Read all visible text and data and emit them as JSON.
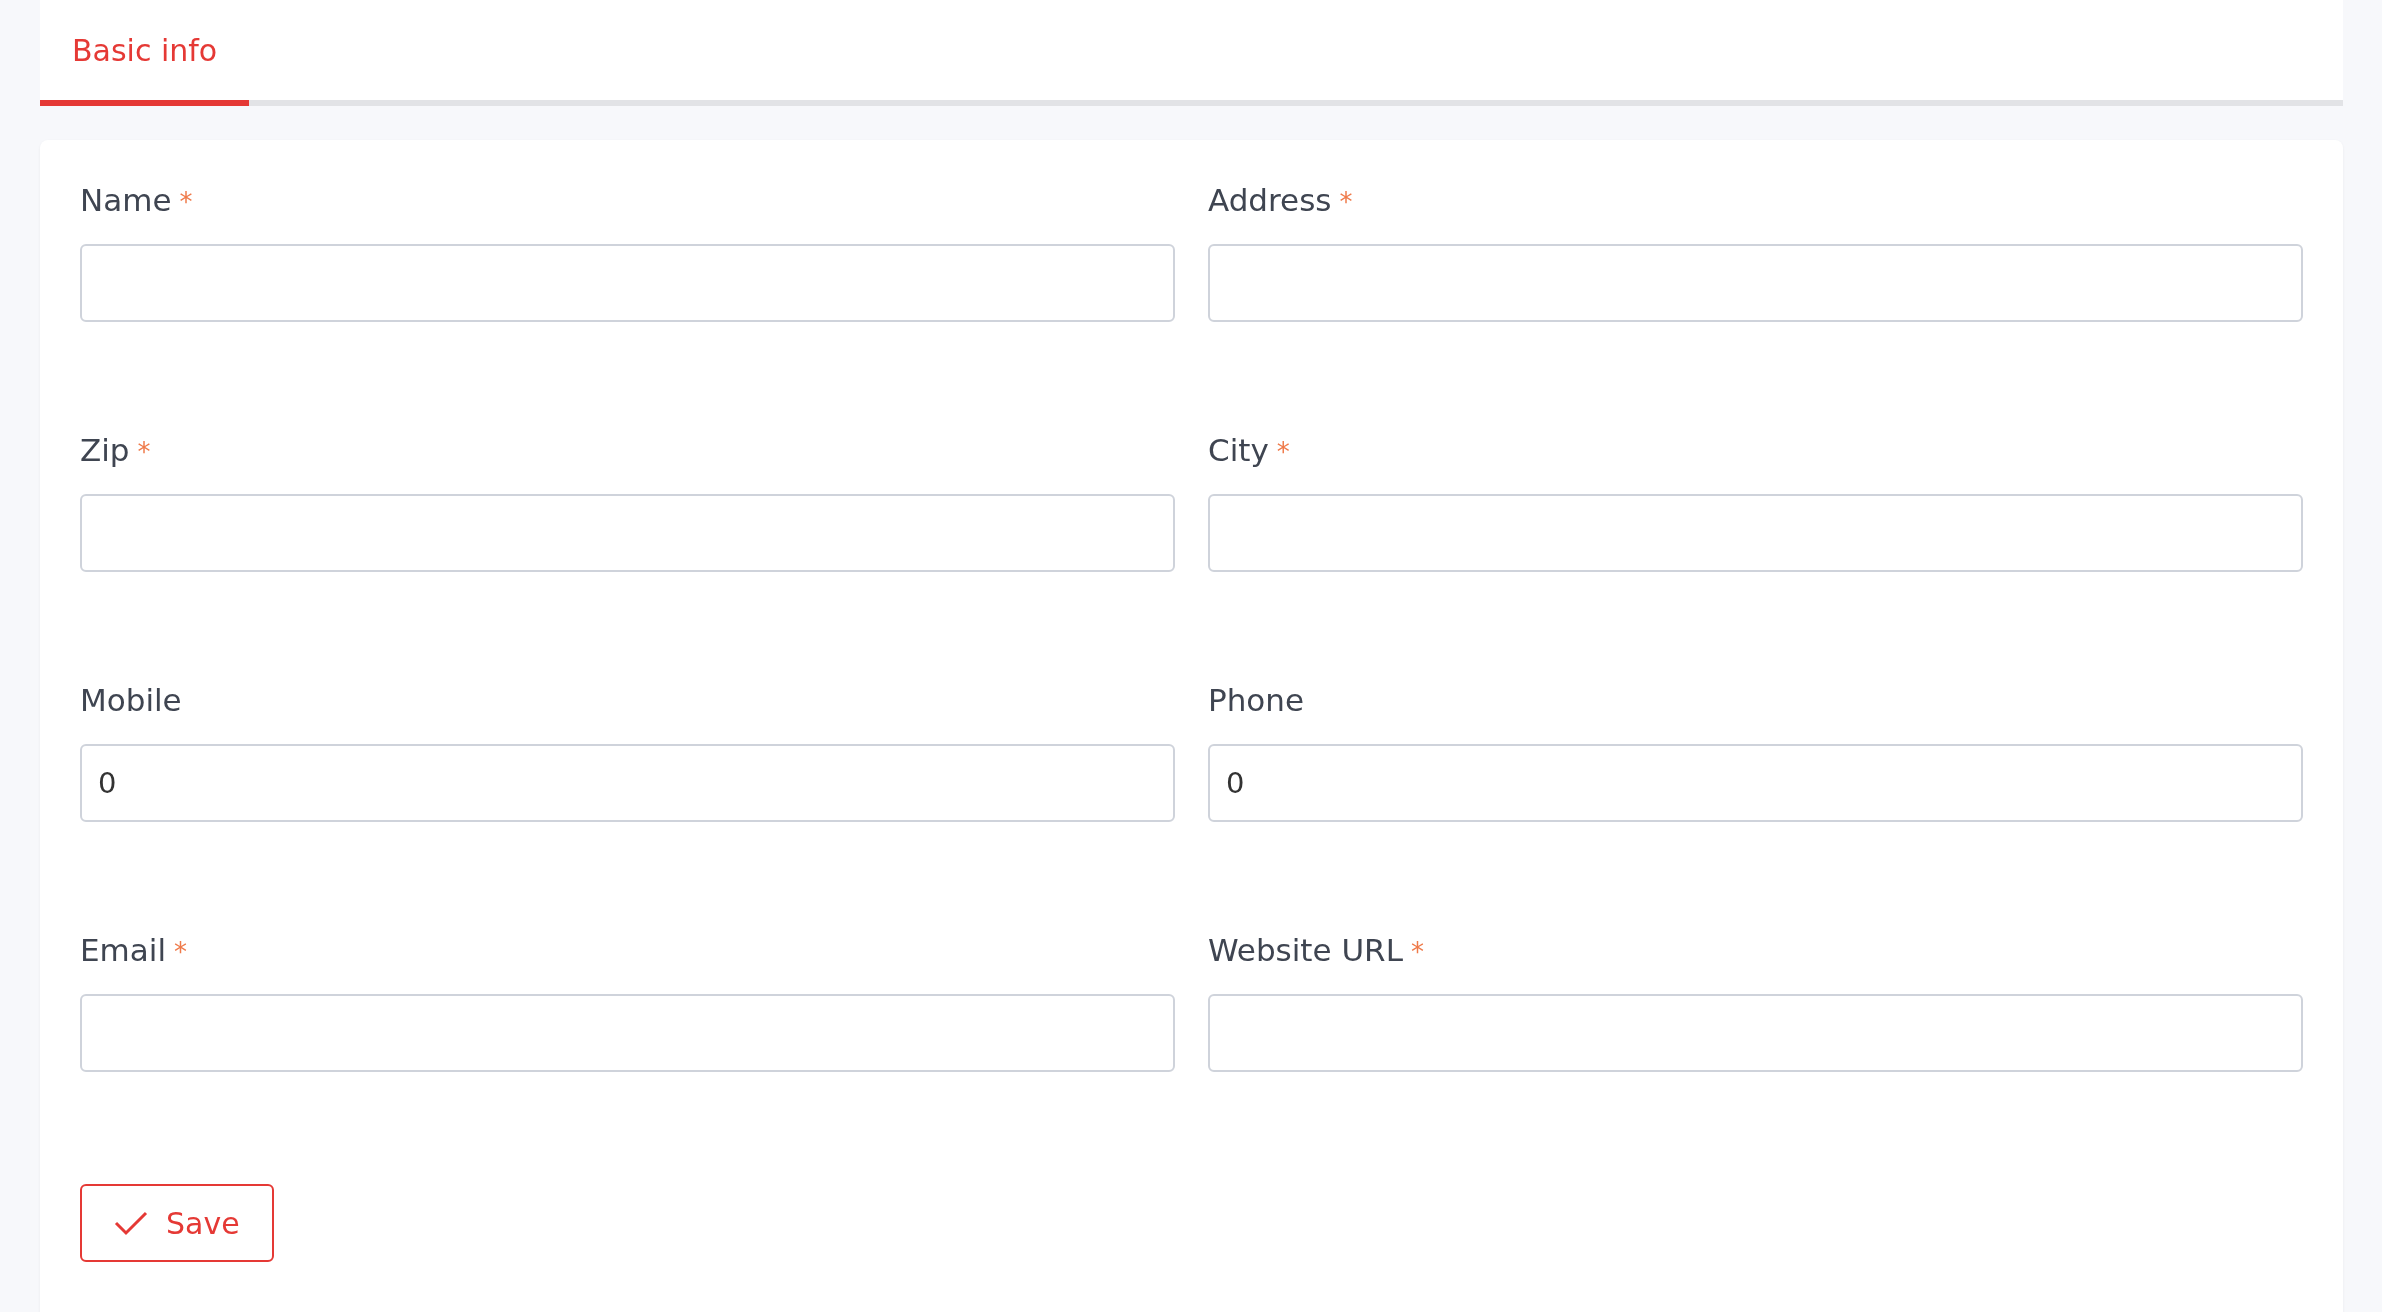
{
  "tabs": [
    {
      "label": "Basic info",
      "selected": true
    }
  ],
  "fields": [
    {
      "label": "Name",
      "required_mark": "*"
    },
    {
      "label": "Address",
      "required_mark": "*"
    },
    {
      "label": "Zip",
      "required_mark": "*"
    },
    {
      "label": "City",
      "required_mark": "*"
    },
    {
      "label": "Mobile",
      "value": "0"
    },
    {
      "label": "Phone",
      "value": "0"
    },
    {
      "label": "Email",
      "required_mark": "*"
    },
    {
      "label": "Website URL",
      "required_mark": "*"
    }
  ],
  "save_button": {
    "label": "Save"
  }
}
